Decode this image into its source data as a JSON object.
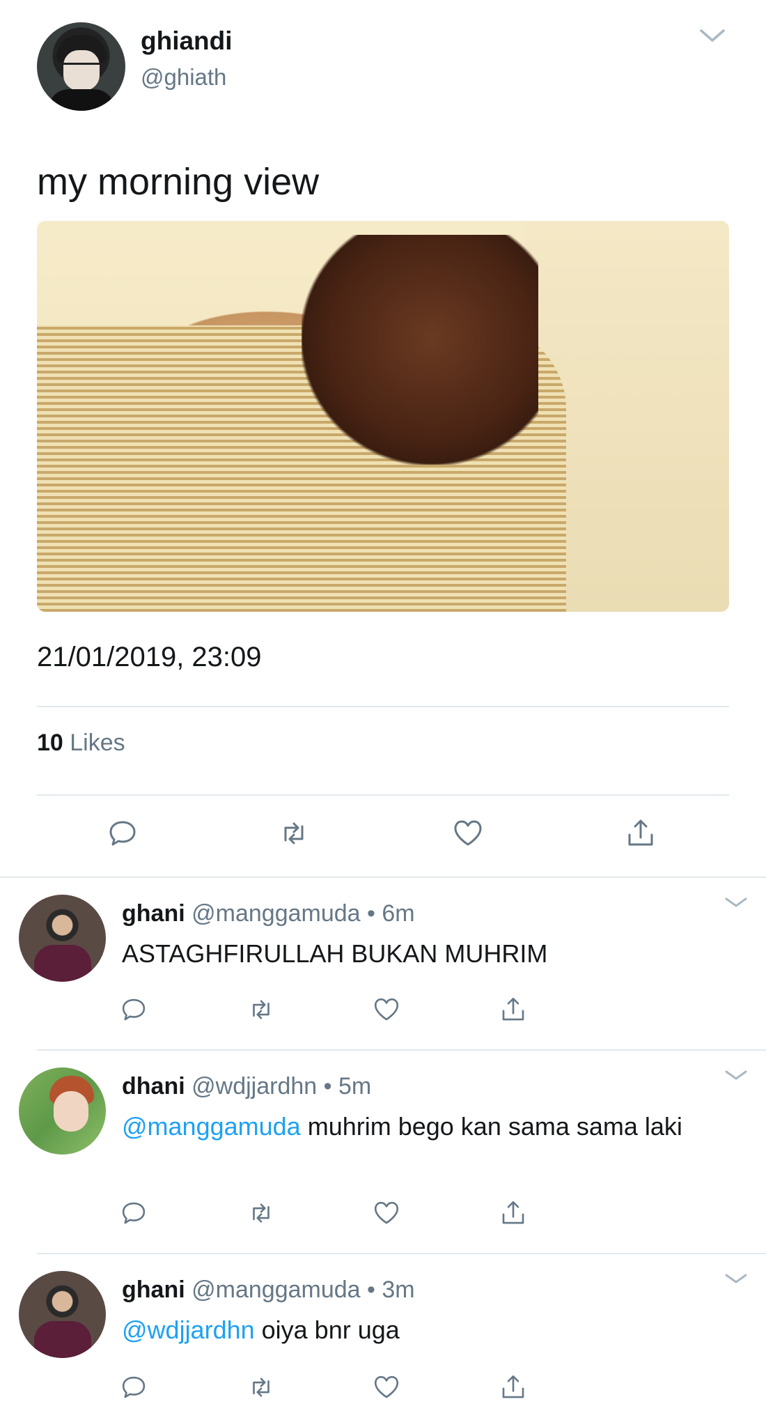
{
  "tweet": {
    "display_name": "ghiandi",
    "handle": "@ghiath",
    "text": "my morning view",
    "timestamp": "21/01/2019, 23:09",
    "likes_count": "10",
    "likes_label": " Likes"
  },
  "replies": [
    {
      "name": "ghani",
      "meta": "@manggamuda • 6m",
      "mention": "",
      "text": "ASTAGHFIRULLAH BUKAN MUHRIM"
    },
    {
      "name": "dhani",
      "meta": "@wdjjardhn • 5m",
      "mention": "@manggamuda",
      "text": " muhrim bego kan sama sama laki"
    },
    {
      "name": "ghani",
      "meta": "@manggamuda • 3m",
      "mention": "@wdjjardhn",
      "text": " oiya bnr uga"
    }
  ],
  "colors": {
    "accent": "#1da1f2",
    "secondary_text": "#657786",
    "divider": "#e1e8ed",
    "icon": "#657786"
  },
  "icons": [
    "reply-icon",
    "retweet-icon",
    "like-icon",
    "share-icon",
    "chevron-down-icon"
  ]
}
